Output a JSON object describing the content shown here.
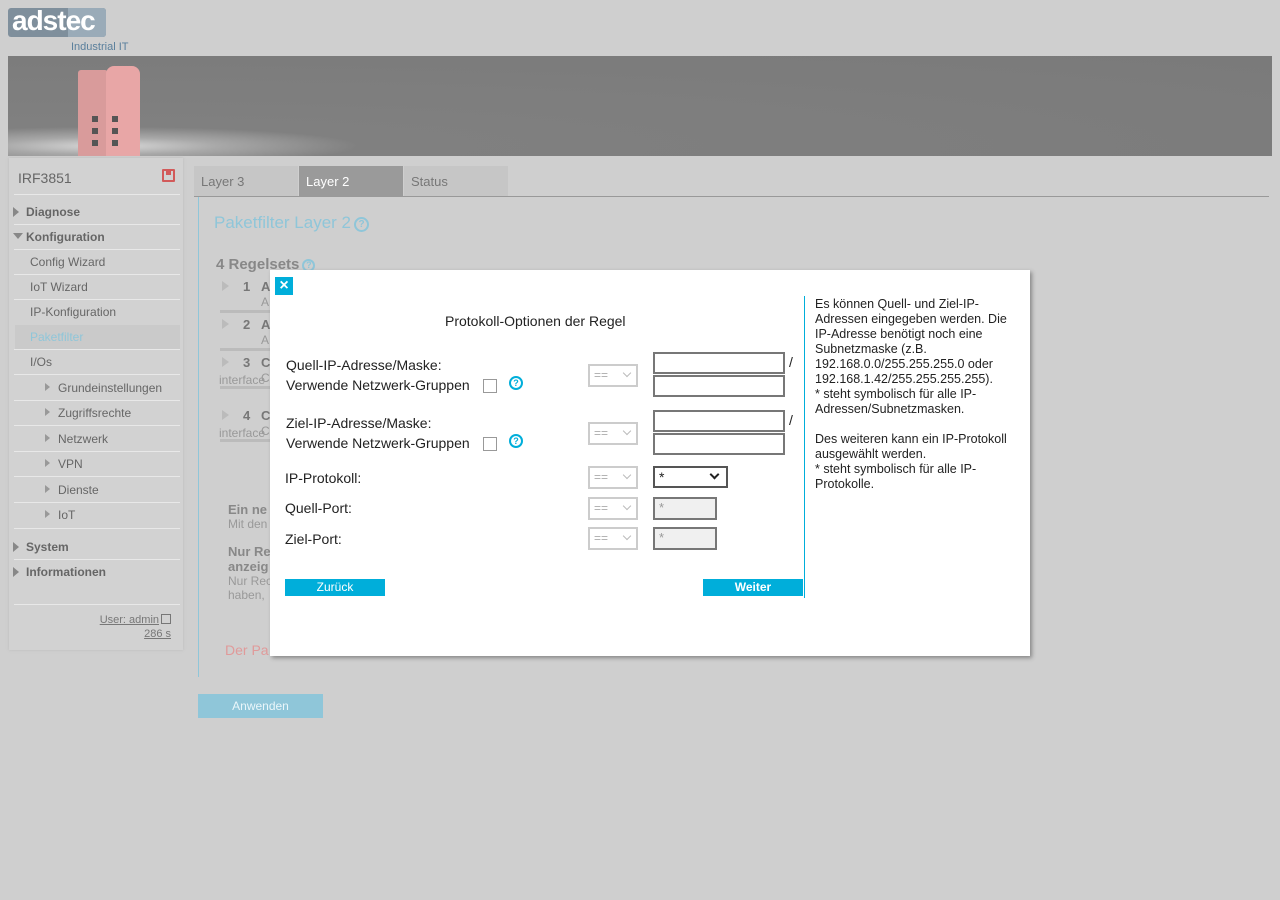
{
  "logo": {
    "text": "adstec",
    "subtitle": "Industrial IT"
  },
  "sidebar": {
    "device_name": "IRF3851",
    "items": [
      {
        "label": "Diagnose"
      },
      {
        "label": "Konfiguration"
      },
      {
        "label": "Config Wizard"
      },
      {
        "label": "IoT Wizard"
      },
      {
        "label": "IP-Konfiguration"
      },
      {
        "label": "Paketfilter"
      },
      {
        "label": "I/Os"
      },
      {
        "label": "Grundeinstellungen"
      },
      {
        "label": "Zugriffsrechte"
      },
      {
        "label": "Netzwerk"
      },
      {
        "label": "VPN"
      },
      {
        "label": "Dienste"
      },
      {
        "label": "IoT"
      },
      {
        "label": "System"
      },
      {
        "label": "Informationen"
      }
    ],
    "user": "User: admin",
    "session_time": "286 s"
  },
  "tabs": [
    {
      "label": "Layer 3"
    },
    {
      "label": "Layer 2"
    },
    {
      "label": "Status"
    }
  ],
  "page": {
    "title": "Paketfilter Layer 2",
    "rulesets_title": "4 Regelsets",
    "rulesets": [
      {
        "num": "1",
        "letter": "A",
        "sub": "A",
        "iface": ""
      },
      {
        "num": "2",
        "letter": "A",
        "sub": "A",
        "iface": ""
      },
      {
        "num": "3",
        "letter": "C",
        "sub": "C",
        "iface": "interface"
      },
      {
        "num": "4",
        "letter": "C",
        "sub": "C",
        "iface": "interface"
      }
    ],
    "option1_title": "Ein ne",
    "option1_sub": "Mit den",
    "option2_title_l1": "Nur Re",
    "option2_title_l2": "anzeig",
    "option2_sub_l1": "Nur Rec",
    "option2_sub_l2": "haben,",
    "red_text": "Der Pa",
    "apply": "Anwenden"
  },
  "modal": {
    "close": "×",
    "title": "Protokoll-Optionen der Regel",
    "source_ip_label": "Quell-IP-Adresse/Maske:",
    "use_groups": "Verwende Netzwerk-Gruppen",
    "dest_ip_label": "Ziel-IP-Adresse/Maske:",
    "ip_protocol_label": "IP-Protokoll:",
    "source_port_label": "Quell-Port:",
    "dest_port_label": "Ziel-Port:",
    "operator": "==",
    "slash": "/",
    "protocol_value": "*",
    "source_port_placeholder": "*",
    "dest_port_placeholder": "*",
    "back": "Zurück",
    "next": "Weiter",
    "help_p1": "Es können Quell- und Ziel-IP-Adressen eingegeben werden. Die IP-Adresse benötigt noch eine Subnetzmaske (z.B. 192.168.0.0/255.255.255.0 oder 192.168.1.42/255.255.255.255).",
    "help_p1b": "* steht symbolisch für alle IP-Adressen/Subnetzmasken.",
    "help_p2": "Des weiteren kann ein IP-Protokoll ausgewählt werden.",
    "help_p2b": "* steht symbolisch für alle IP-Protokolle."
  },
  "colors": {
    "accent": "#00aeda",
    "accent_light": "#8fc6d9"
  }
}
